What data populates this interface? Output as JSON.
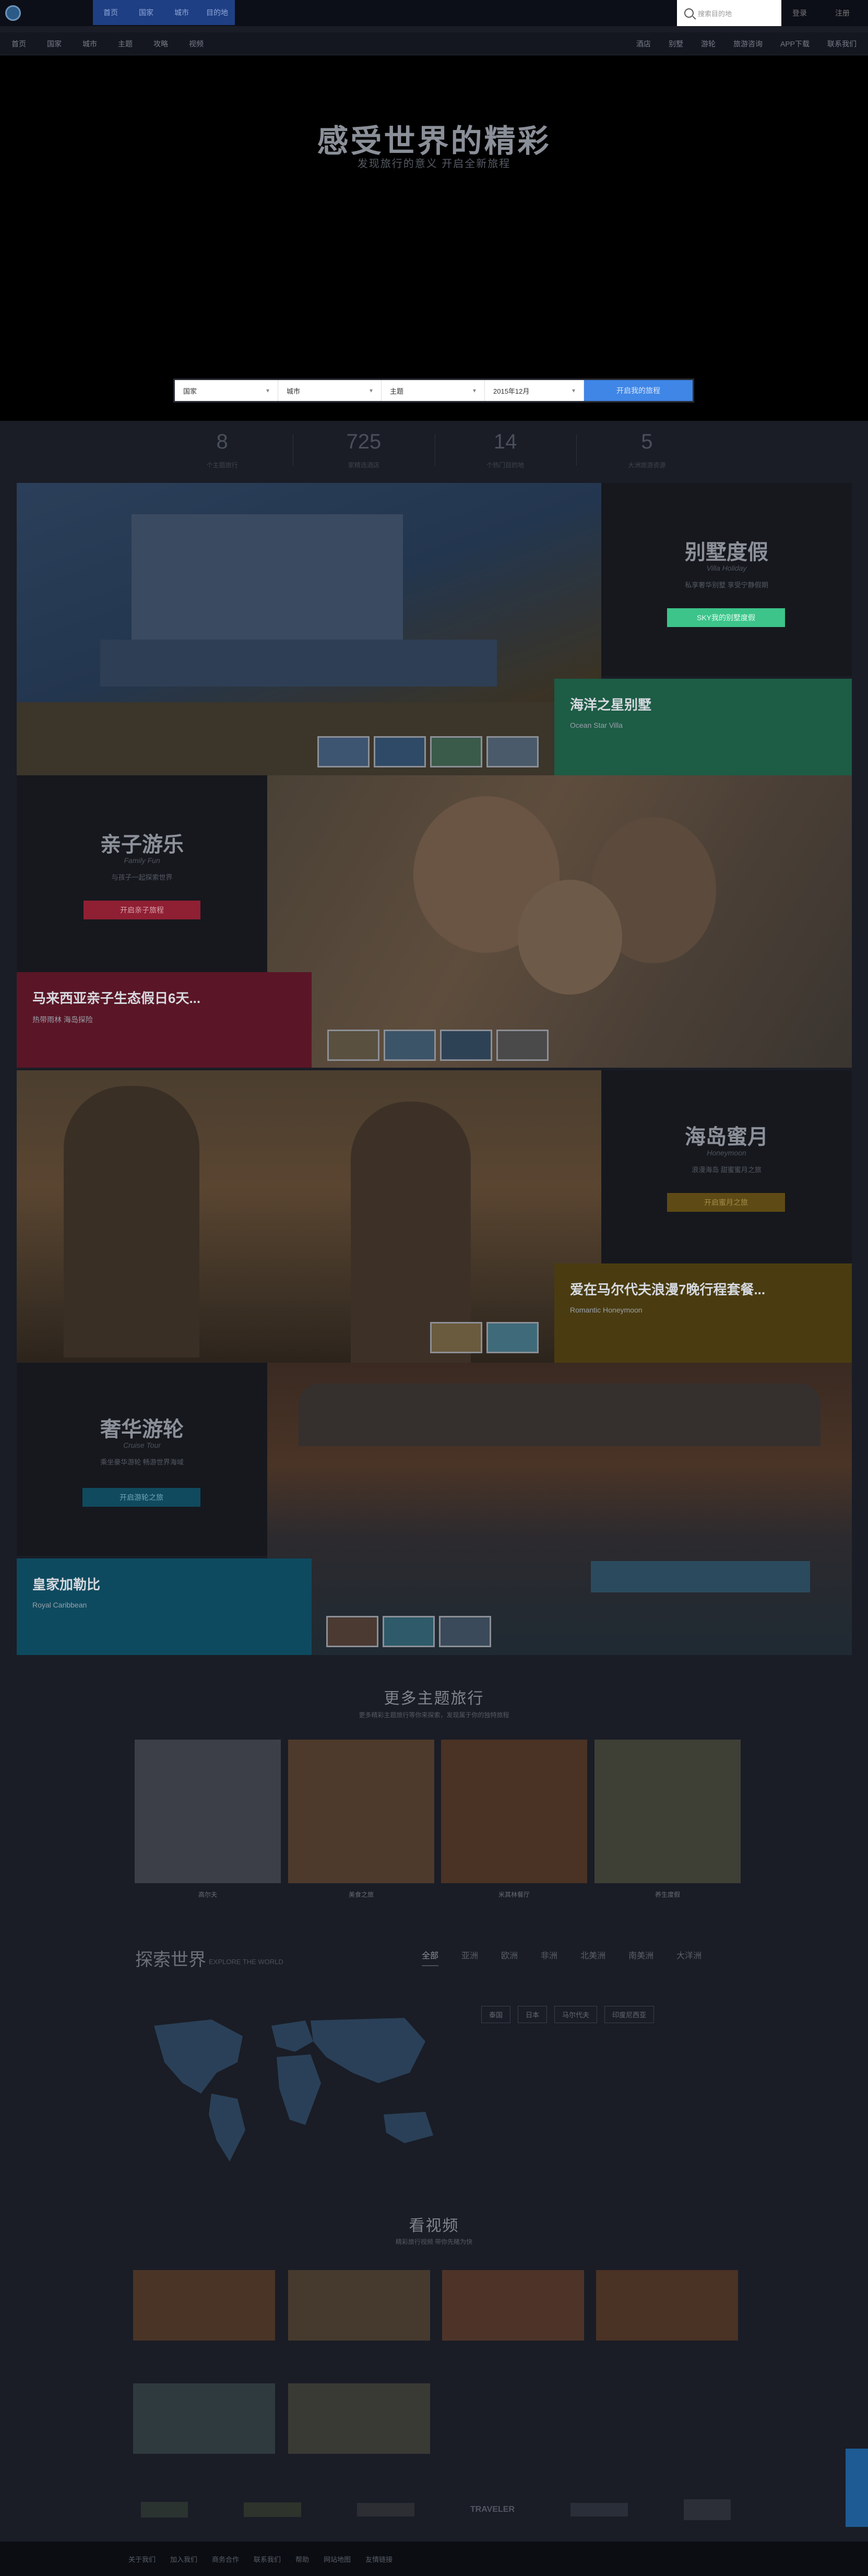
{
  "header": {
    "nav": [
      "首页",
      "国家",
      "城市",
      "目的地"
    ],
    "search_placeholder": "搜索目的地",
    "login": "登录",
    "register": "注册"
  },
  "subnav": {
    "left": [
      "首页",
      "国家",
      "城市",
      "主题",
      "攻略",
      "视频"
    ],
    "right": [
      "酒店",
      "别墅",
      "游轮",
      "旅游咨询",
      "APP下载",
      "联系我们"
    ]
  },
  "hero": {
    "title": "感受世界的精彩",
    "subtitle": "发现旅行的意义 开启全新旅程"
  },
  "filter": {
    "country": "国家",
    "city": "城市",
    "theme": "主题",
    "date": "2015年12月",
    "button": "开启我的旅程"
  },
  "stats": [
    {
      "num": "8",
      "label": "个主题旅行"
    },
    {
      "num": "725",
      "label": "家精选酒店"
    },
    {
      "num": "14",
      "label": "个热门目的地"
    },
    {
      "num": "5",
      "label": "大洲旅游资源"
    }
  ],
  "themes": {
    "villa": {
      "title": "别墅度假",
      "subtitle": "Villa Holiday",
      "desc": "私享奢华别墅 享受宁静假期",
      "button": "SKY我的别墅度假",
      "banner_title": "海洋之星别墅",
      "banner_sub": "Ocean Star Villa"
    },
    "family": {
      "title": "亲子游乐",
      "subtitle": "Family Fun",
      "desc": "与孩子一起探索世界",
      "button": "开启亲子旅程",
      "banner_title": "马来西亚亲子生态假日6天...",
      "banner_sub": "热带雨林 海岛探险"
    },
    "honeymoon": {
      "title": "海岛蜜月",
      "subtitle": "Honeymoon",
      "desc": "浪漫海岛 甜蜜蜜月之旅",
      "button": "开启蜜月之旅",
      "banner_title": "爱在马尔代夫浪漫7晚行程套餐...",
      "banner_sub": "Romantic Honeymoon"
    },
    "cruise": {
      "title": "奢华游轮",
      "subtitle": "Cruise Tour",
      "desc": "乘坐豪华游轮 畅游世界海域",
      "button": "开启游轮之旅",
      "banner_title": "皇家加勒比",
      "banner_sub": "Royal Caribbean"
    }
  },
  "more": {
    "title": "更多主题旅行",
    "subtitle": "更多精彩主题旅行等你来探索，发现属于你的独特旅程",
    "tiles": [
      "高尔夫",
      "美食之旅",
      "米其林餐厅",
      "养生度假"
    ]
  },
  "explore": {
    "title": "探索世界",
    "subtitle": "EXPLORE THE WORLD",
    "regions": [
      "全部",
      "亚洲",
      "欧洲",
      "非洲",
      "北美洲",
      "南美洲",
      "大洋洲"
    ],
    "chips": [
      "泰国",
      "日本",
      "马尔代夫",
      "印度尼西亚"
    ]
  },
  "videos": {
    "title": "看视频",
    "subtitle": "精彩旅行视频 带你先睹为快",
    "items": [
      "",
      "",
      "",
      "",
      "",
      ""
    ]
  },
  "partners": [
    "",
    "",
    "",
    "TRAVELER",
    "",
    ""
  ],
  "footer": {
    "links": [
      "关于我们",
      "加入我们",
      "商务合作",
      "联系我们",
      "帮助",
      "网站地图",
      "友情链接"
    ]
  },
  "colors": {
    "villa_accent": "#3cc48a",
    "family_accent": "#a3243a",
    "honeymoon_accent": "#9a7a1e",
    "cruise_accent": "#1a7fa0",
    "filter_button": "#3f86e6"
  }
}
